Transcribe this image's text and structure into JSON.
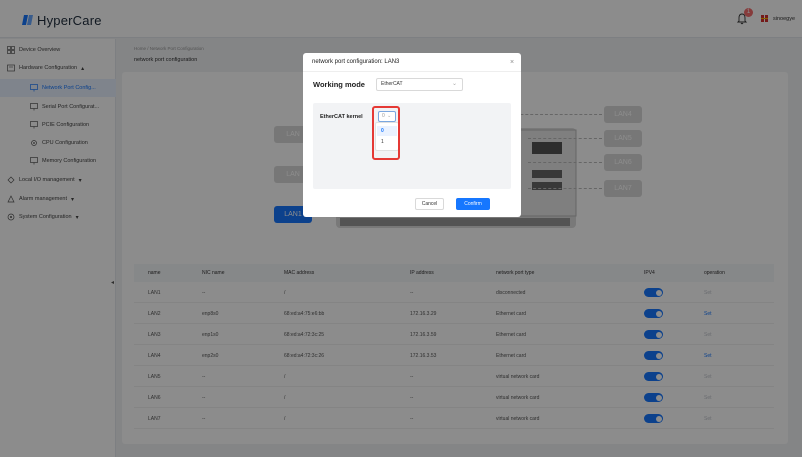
{
  "app": {
    "name": "HyperCare",
    "notification_count": "1",
    "user_name": "sinoegye"
  },
  "sidebar": {
    "items": [
      {
        "label": "Device Overview",
        "icon": "grid-icon"
      },
      {
        "label": "Hardware Configuration",
        "icon": "hardware-icon",
        "chevron": "▴"
      },
      {
        "label": "Network Port Config...",
        "icon": "network-icon",
        "active": true
      },
      {
        "label": "Serial Port Configurat...",
        "icon": "serial-icon"
      },
      {
        "label": "PCIE Configuration",
        "icon": "pcie-icon"
      },
      {
        "label": "CPU Configuration",
        "icon": "cpu-icon"
      },
      {
        "label": "Memory Configuration",
        "icon": "memory-icon"
      },
      {
        "label": "Local I/O management",
        "icon": "io-icon",
        "chevron": "▾"
      },
      {
        "label": "Alarm management",
        "icon": "alarm-icon",
        "chevron": "▾"
      },
      {
        "label": "System Configuration",
        "icon": "system-icon",
        "chevron": "▾"
      }
    ],
    "collapse_glyph": "◂"
  },
  "breadcrumb": "Home / Network Port Configuration",
  "page_title": "network port configuration",
  "diagram": {
    "lans": [
      "LAN4",
      "LAN5",
      "LAN6",
      "LAN7"
    ],
    "left_lans": [
      "LAN",
      "LAN",
      "LAN1"
    ]
  },
  "table": {
    "headers": [
      "name",
      "NIC name",
      "MAC address",
      "IP address",
      "network port type",
      "IPV4",
      "operation"
    ],
    "rows": [
      {
        "name": "LAN1",
        "nic": "--",
        "mac": "/",
        "ip": "--",
        "type": "disconnected",
        "op": "Set",
        "op_enabled": false
      },
      {
        "name": "LAN2",
        "nic": "enp8s0",
        "mac": "68:ed:a4:75:e6:bb",
        "ip": "172.16.3.29",
        "type": "Ethernet card",
        "op": "Set",
        "op_enabled": true
      },
      {
        "name": "LAN3",
        "nic": "enp1s0",
        "mac": "68:ed:a4:72:3c:25",
        "ip": "172.16.3.59",
        "type": "Ethernet card",
        "op": "Set",
        "op_enabled": false
      },
      {
        "name": "LAN4",
        "nic": "enp2s0",
        "mac": "68:ed:a4:72:3c:26",
        "ip": "172.16.3.53",
        "type": "Ethernet card",
        "op": "Set",
        "op_enabled": true
      },
      {
        "name": "LAN5",
        "nic": "--",
        "mac": "/",
        "ip": "--",
        "type": "virtual network card",
        "op": "Set",
        "op_enabled": false
      },
      {
        "name": "LAN6",
        "nic": "--",
        "mac": "/",
        "ip": "--",
        "type": "virtual network card",
        "op": "Set",
        "op_enabled": false
      },
      {
        "name": "LAN7",
        "nic": "--",
        "mac": "/",
        "ip": "--",
        "type": "virtual network card",
        "op": "Set",
        "op_enabled": false
      }
    ]
  },
  "modal": {
    "title": "network port configuration: LAN3",
    "close": "×",
    "working_mode_label": "Working mode",
    "working_mode_value": "EtherCAT",
    "kernel_label": "EtherCAT kernel",
    "kernel_value": "0",
    "kernel_options": [
      "0",
      "1"
    ],
    "cancel": "Cancel",
    "confirm": "Confirm"
  },
  "colors": {
    "accent": "#1677ff",
    "badge": "#f56c6c",
    "highlight": "#e53935"
  }
}
